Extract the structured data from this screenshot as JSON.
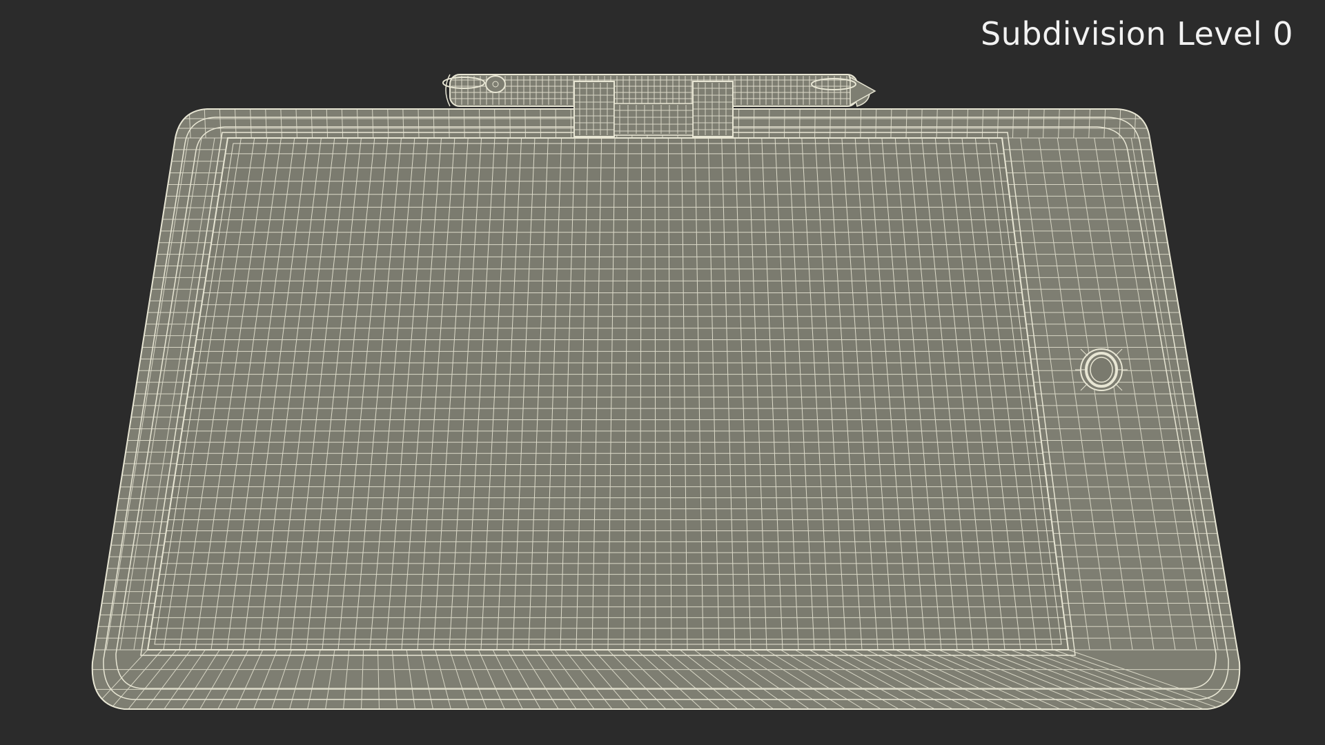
{
  "overlay": {
    "label": "Subdivision Level 0"
  },
  "colors": {
    "background": "#2b2b2b",
    "surface": "#7c7c70",
    "surface_light": "#8a8a7e",
    "wire": "#e8e6d4",
    "text": "#f2f2f2"
  },
  "scene": {
    "subject": "tablet-with-stylus-wireframe"
  }
}
